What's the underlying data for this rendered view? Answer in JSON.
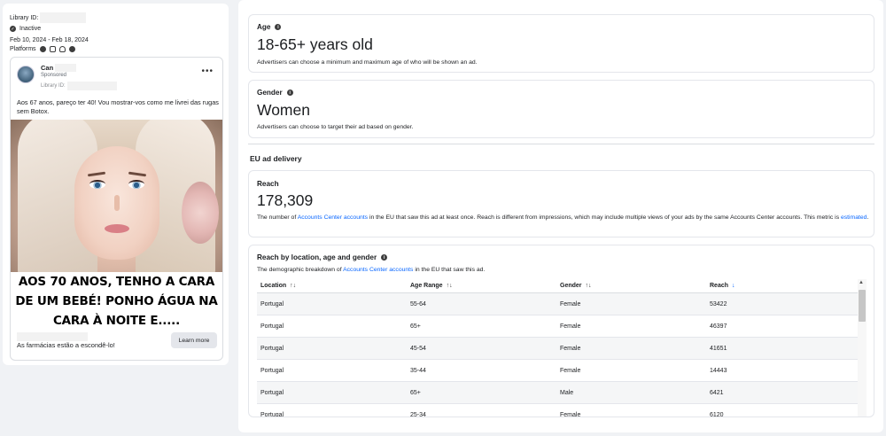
{
  "left": {
    "library_id_label": "Library ID:",
    "status": "Inactive",
    "dates": "Feb 10, 2024 - Feb 18, 2024",
    "platforms_label": "Platforms",
    "platform_icons": [
      "facebook-icon",
      "instagram-icon",
      "messenger-icon",
      "audience-network-icon"
    ],
    "ad": {
      "advertiser_name": "Can",
      "sponsored": "Sponsored",
      "library_id_label": "Library ID:",
      "body_text": "Aos 67 anos, pareço ter 40! Vou mostrar-vos como me livrei das rugas sem Botox.",
      "image_caption": "AOS 70 ANOS, TENHO A CARA DE UM BEBÉ! PONHO ÁGUA NA CARA À NOITE E.....",
      "footer_text": "As farmácias estão a escondê-lo!",
      "cta_label": "Learn more"
    }
  },
  "right": {
    "age": {
      "title": "Age",
      "value": "18-65+ years old",
      "description": "Advertisers can choose a minimum and maximum age of who will be shown an ad."
    },
    "gender": {
      "title": "Gender",
      "value": "Women",
      "description": "Advertisers can choose to target their ad based on gender."
    },
    "eu_section_title": "EU ad delivery",
    "reach": {
      "title": "Reach",
      "value": "178,309",
      "desc_part1": "The number of ",
      "desc_link1": "Accounts Center accounts",
      "desc_part2": " in the EU that saw this ad at least once. Reach is different from impressions, which may include multiple views of your ads by the same Accounts Center accounts. This metric is ",
      "desc_link2": "estimated",
      "desc_part3": "."
    },
    "breakdown": {
      "title": "Reach by location, age and gender",
      "desc_part1": "The demographic breakdown of ",
      "desc_link": "Accounts Center accounts",
      "desc_part2": " in the EU that saw this ad.",
      "columns": [
        "Location",
        "Age Range",
        "Gender",
        "Reach"
      ],
      "rows": [
        [
          "Portugal",
          "55-64",
          "Female",
          "53422"
        ],
        [
          "Portugal",
          "65+",
          "Female",
          "46397"
        ],
        [
          "Portugal",
          "45-54",
          "Female",
          "41651"
        ],
        [
          "Portugal",
          "35-44",
          "Female",
          "14443"
        ],
        [
          "Portugal",
          "65+",
          "Male",
          "6421"
        ],
        [
          "Portugal",
          "25-34",
          "Female",
          "6120"
        ]
      ]
    }
  }
}
